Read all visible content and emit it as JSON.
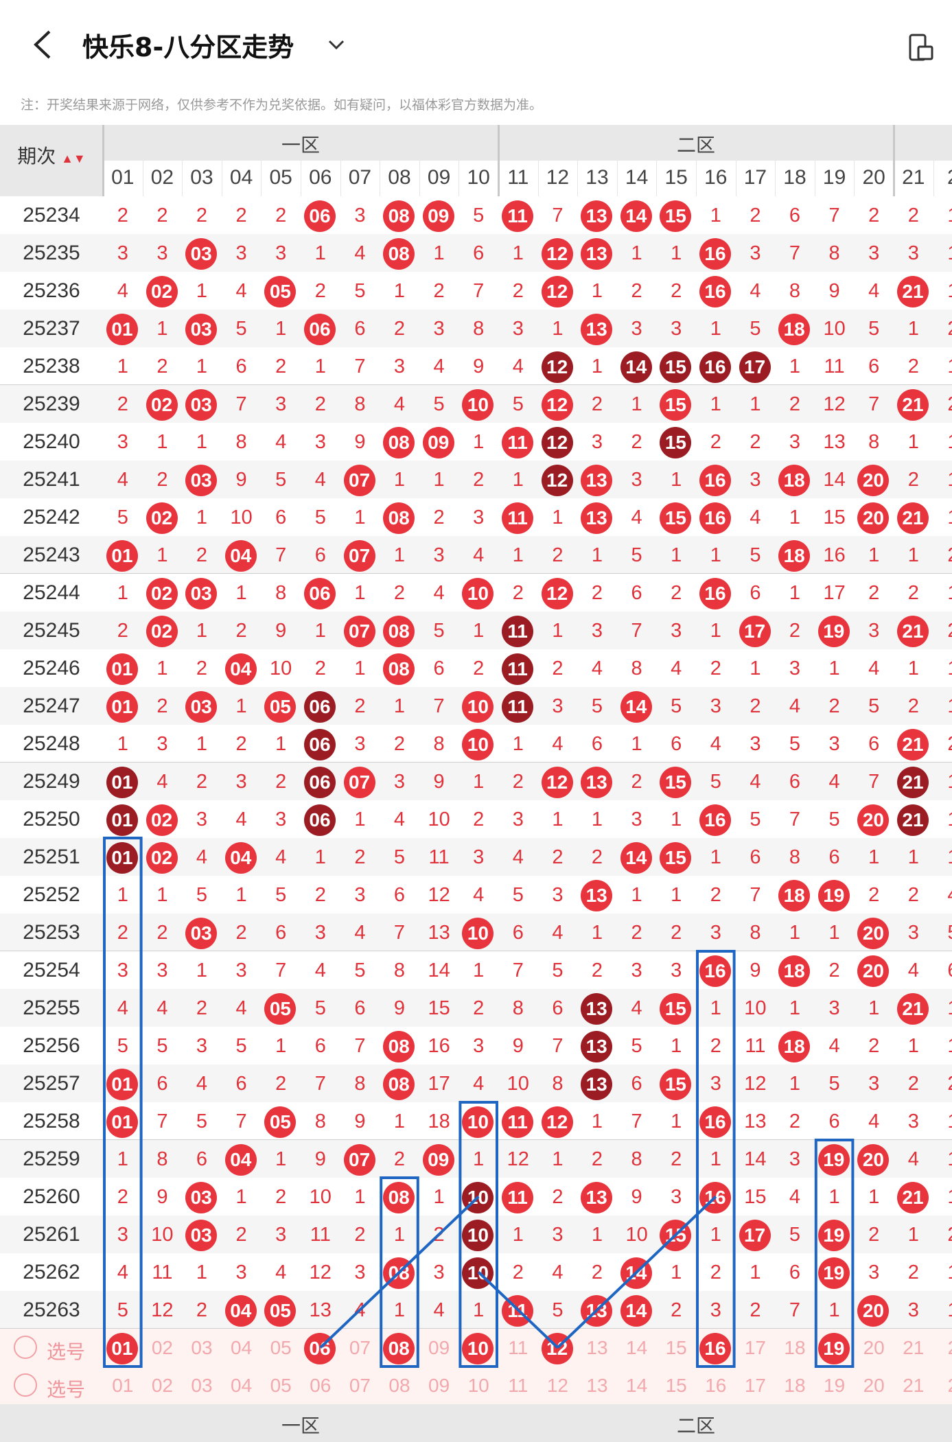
{
  "header": {
    "title": "快乐8-八分区走势",
    "note": "注：开奖结果来源于网络，仅供参考不作为兑奖依据。如有疑问，以福体彩官方数据为准。"
  },
  "table": {
    "issue_header": "期次",
    "zone1": "一区",
    "zone2": "二区",
    "columns": [
      "01",
      "02",
      "03",
      "04",
      "05",
      "06",
      "07",
      "08",
      "09",
      "10",
      "11",
      "12",
      "13",
      "14",
      "15",
      "16",
      "17",
      "18",
      "19",
      "20",
      "21",
      "2"
    ],
    "rows": [
      {
        "issue": "25234",
        "v": [
          "2",
          "2",
          "2",
          "2",
          "2",
          "06",
          "3",
          "08",
          "09",
          "5",
          "11",
          "7",
          "13",
          "14",
          "15",
          "1",
          "2",
          "6",
          "7",
          "2",
          "2",
          "1"
        ]
      },
      {
        "issue": "25235",
        "v": [
          "3",
          "3",
          "03",
          "3",
          "3",
          "1",
          "4",
          "08",
          "1",
          "6",
          "1",
          "12",
          "13",
          "1",
          "1",
          "16",
          "3",
          "7",
          "8",
          "3",
          "3",
          "1"
        ]
      },
      {
        "issue": "25236",
        "v": [
          "4",
          "02",
          "1",
          "4",
          "05",
          "2",
          "5",
          "1",
          "2",
          "7",
          "2",
          "12",
          "1",
          "2",
          "2",
          "16",
          "4",
          "8",
          "9",
          "4",
          "21",
          "1"
        ]
      },
      {
        "issue": "25237",
        "v": [
          "01",
          "1",
          "03",
          "5",
          "1",
          "06",
          "6",
          "2",
          "3",
          "8",
          "3",
          "1",
          "13",
          "3",
          "3",
          "1",
          "5",
          "18",
          "10",
          "5",
          "1",
          "2"
        ]
      },
      {
        "issue": "25238",
        "v": [
          "1",
          "2",
          "1",
          "6",
          "2",
          "1",
          "7",
          "3",
          "4",
          "9",
          "4",
          "12",
          "1",
          "14",
          "15",
          "16",
          "17",
          "1",
          "11",
          "6",
          "2",
          "1"
        ]
      },
      {
        "issue": "25239",
        "v": [
          "2",
          "02",
          "03",
          "7",
          "3",
          "2",
          "8",
          "4",
          "5",
          "10",
          "5",
          "12",
          "2",
          "1",
          "15",
          "1",
          "1",
          "2",
          "12",
          "7",
          "21",
          "2"
        ]
      },
      {
        "issue": "25240",
        "v": [
          "3",
          "1",
          "1",
          "8",
          "4",
          "3",
          "9",
          "08",
          "09",
          "1",
          "11",
          "12",
          "3",
          "2",
          "15",
          "2",
          "2",
          "3",
          "13",
          "8",
          "1",
          "1"
        ]
      },
      {
        "issue": "25241",
        "v": [
          "4",
          "2",
          "03",
          "9",
          "5",
          "4",
          "07",
          "1",
          "1",
          "2",
          "1",
          "12",
          "13",
          "3",
          "1",
          "16",
          "3",
          "18",
          "14",
          "20",
          "2",
          "1"
        ]
      },
      {
        "issue": "25242",
        "v": [
          "5",
          "02",
          "1",
          "10",
          "6",
          "5",
          "1",
          "08",
          "2",
          "3",
          "11",
          "1",
          "13",
          "4",
          "15",
          "16",
          "4",
          "1",
          "15",
          "20",
          "21",
          "1"
        ]
      },
      {
        "issue": "25243",
        "v": [
          "01",
          "1",
          "2",
          "04",
          "7",
          "6",
          "07",
          "1",
          "3",
          "4",
          "1",
          "2",
          "1",
          "5",
          "1",
          "1",
          "5",
          "18",
          "16",
          "1",
          "1",
          "2"
        ]
      },
      {
        "issue": "25244",
        "v": [
          "1",
          "02",
          "03",
          "1",
          "8",
          "06",
          "1",
          "2",
          "4",
          "10",
          "2",
          "12",
          "2",
          "6",
          "2",
          "16",
          "6",
          "1",
          "17",
          "2",
          "2",
          "1"
        ]
      },
      {
        "issue": "25245",
        "v": [
          "2",
          "02",
          "1",
          "2",
          "9",
          "1",
          "07",
          "08",
          "5",
          "1",
          "11",
          "1",
          "3",
          "7",
          "3",
          "1",
          "17",
          "2",
          "19",
          "3",
          "21",
          "2"
        ]
      },
      {
        "issue": "25246",
        "v": [
          "01",
          "1",
          "2",
          "04",
          "10",
          "2",
          "1",
          "08",
          "6",
          "2",
          "11",
          "2",
          "4",
          "8",
          "4",
          "2",
          "1",
          "3",
          "1",
          "4",
          "1",
          "1"
        ]
      },
      {
        "issue": "25247",
        "v": [
          "01",
          "2",
          "03",
          "1",
          "05",
          "06",
          "2",
          "1",
          "7",
          "10",
          "11",
          "3",
          "5",
          "14",
          "5",
          "3",
          "2",
          "4",
          "2",
          "5",
          "2",
          "1"
        ]
      },
      {
        "issue": "25248",
        "v": [
          "1",
          "3",
          "1",
          "2",
          "1",
          "06",
          "3",
          "2",
          "8",
          "10",
          "1",
          "4",
          "6",
          "1",
          "6",
          "4",
          "3",
          "5",
          "3",
          "6",
          "21",
          "2"
        ]
      },
      {
        "issue": "25249",
        "v": [
          "01",
          "4",
          "2",
          "3",
          "2",
          "06",
          "07",
          "3",
          "9",
          "1",
          "2",
          "12",
          "13",
          "2",
          "15",
          "5",
          "4",
          "6",
          "4",
          "7",
          "21",
          "1"
        ]
      },
      {
        "issue": "25250",
        "v": [
          "01",
          "02",
          "3",
          "4",
          "3",
          "06",
          "1",
          "4",
          "10",
          "2",
          "3",
          "1",
          "1",
          "3",
          "1",
          "16",
          "5",
          "7",
          "5",
          "20",
          "21",
          "1"
        ]
      },
      {
        "issue": "25251",
        "v": [
          "01",
          "02",
          "4",
          "04",
          "4",
          "1",
          "2",
          "5",
          "11",
          "3",
          "4",
          "2",
          "2",
          "14",
          "15",
          "1",
          "6",
          "8",
          "6",
          "1",
          "1",
          "1"
        ]
      },
      {
        "issue": "25252",
        "v": [
          "1",
          "1",
          "5",
          "1",
          "5",
          "2",
          "3",
          "6",
          "12",
          "4",
          "5",
          "3",
          "13",
          "1",
          "1",
          "2",
          "7",
          "18",
          "19",
          "2",
          "2",
          "4"
        ]
      },
      {
        "issue": "25253",
        "v": [
          "2",
          "2",
          "03",
          "2",
          "6",
          "3",
          "4",
          "7",
          "13",
          "10",
          "6",
          "4",
          "1",
          "2",
          "2",
          "3",
          "8",
          "1",
          "1",
          "20",
          "3",
          "5"
        ]
      },
      {
        "issue": "25254",
        "v": [
          "3",
          "3",
          "1",
          "3",
          "7",
          "4",
          "5",
          "8",
          "14",
          "1",
          "7",
          "5",
          "2",
          "3",
          "3",
          "16",
          "9",
          "18",
          "2",
          "20",
          "4",
          "6"
        ]
      },
      {
        "issue": "25255",
        "v": [
          "4",
          "4",
          "2",
          "4",
          "05",
          "5",
          "6",
          "9",
          "15",
          "2",
          "8",
          "6",
          "13",
          "4",
          "15",
          "1",
          "10",
          "1",
          "3",
          "1",
          "21",
          "1"
        ]
      },
      {
        "issue": "25256",
        "v": [
          "5",
          "5",
          "3",
          "5",
          "1",
          "6",
          "7",
          "08",
          "16",
          "3",
          "9",
          "7",
          "13",
          "5",
          "1",
          "2",
          "11",
          "18",
          "4",
          "2",
          "1",
          "1"
        ]
      },
      {
        "issue": "25257",
        "v": [
          "01",
          "6",
          "4",
          "6",
          "2",
          "7",
          "8",
          "08",
          "17",
          "4",
          "10",
          "8",
          "13",
          "6",
          "15",
          "3",
          "12",
          "1",
          "5",
          "3",
          "2",
          "2"
        ]
      },
      {
        "issue": "25258",
        "v": [
          "01",
          "7",
          "5",
          "7",
          "05",
          "8",
          "9",
          "1",
          "18",
          "10",
          "11",
          "12",
          "1",
          "7",
          "1",
          "16",
          "13",
          "2",
          "6",
          "4",
          "3",
          "1"
        ]
      },
      {
        "issue": "25259",
        "v": [
          "1",
          "8",
          "6",
          "04",
          "1",
          "9",
          "07",
          "2",
          "09",
          "1",
          "12",
          "1",
          "2",
          "8",
          "2",
          "1",
          "14",
          "3",
          "19",
          "20",
          "4",
          "1"
        ]
      },
      {
        "issue": "25260",
        "v": [
          "2",
          "9",
          "03",
          "1",
          "2",
          "10",
          "1",
          "08",
          "1",
          "10",
          "11",
          "2",
          "13",
          "9",
          "3",
          "16",
          "15",
          "4",
          "1",
          "1",
          "21",
          "1"
        ]
      },
      {
        "issue": "25261",
        "v": [
          "3",
          "10",
          "03",
          "2",
          "3",
          "11",
          "2",
          "1",
          "2",
          "10",
          "1",
          "3",
          "1",
          "10",
          "15",
          "1",
          "17",
          "5",
          "19",
          "2",
          "1",
          "2"
        ]
      },
      {
        "issue": "25262",
        "v": [
          "4",
          "11",
          "1",
          "3",
          "4",
          "12",
          "3",
          "08",
          "3",
          "10",
          "2",
          "4",
          "2",
          "14",
          "1",
          "2",
          "1",
          "6",
          "19",
          "3",
          "2",
          "1"
        ]
      },
      {
        "issue": "25263",
        "v": [
          "5",
          "12",
          "2",
          "04",
          "05",
          "13",
          "4",
          "1",
          "4",
          "1",
          "11",
          "5",
          "13",
          "14",
          "2",
          "3",
          "2",
          "7",
          "1",
          "20",
          "3",
          "1"
        ]
      }
    ],
    "pick_label": "选号",
    "pick1_selected": [
      "01",
      "08",
      "10",
      "12",
      "16",
      "19",
      "06"
    ],
    "bottom_zone1": "一区",
    "bottom_zone2": "二区"
  }
}
